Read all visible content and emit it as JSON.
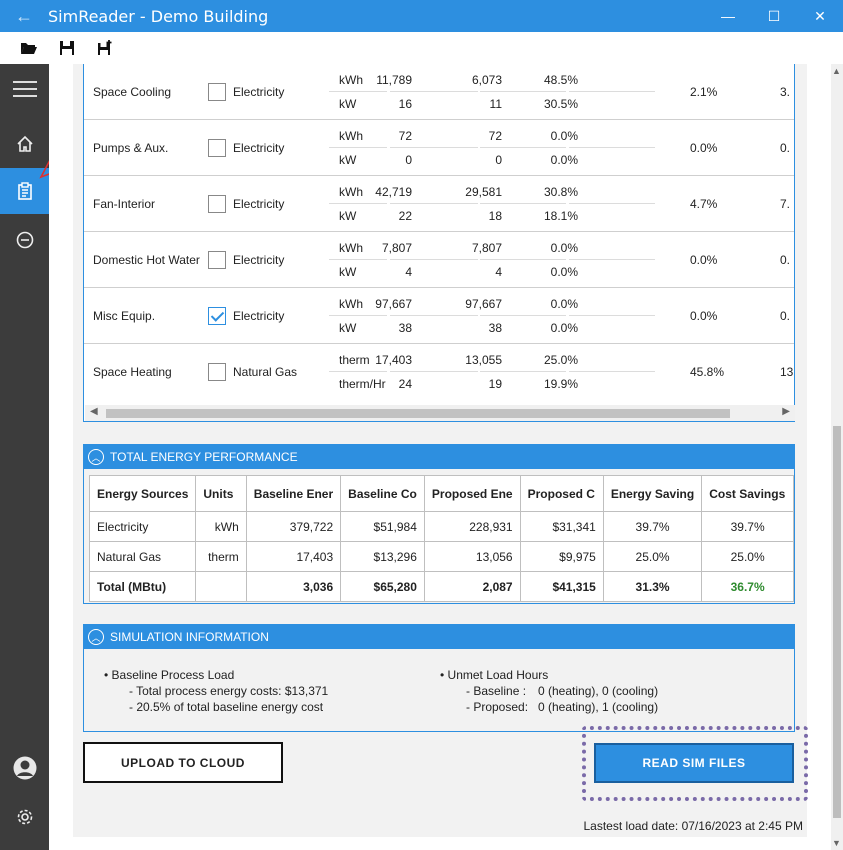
{
  "window": {
    "title": "SimReader - Demo Building",
    "back_glyph": "←",
    "minimize_glyph": "—",
    "maximize_glyph": "☐",
    "close_glyph": "✕"
  },
  "toolbar": {
    "icons": [
      "folder-open-icon",
      "save-icon",
      "save-as-icon"
    ]
  },
  "sidebar": {
    "items": [
      "menu-icon",
      "home-icon",
      "clipboard-icon",
      "more-icon",
      "user-icon",
      "gear-icon"
    ],
    "active": "clipboard-icon"
  },
  "end_uses": [
    {
      "name": "Space Cooling",
      "checked": false,
      "fuel": "Electricity",
      "rows": [
        {
          "unit": "kWh",
          "v1": "11,789",
          "v2": "6,073",
          "v3": "48.5%"
        },
        {
          "unit": "kW",
          "v1": "16",
          "v2": "11",
          "v3": "30.5%"
        }
      ],
      "extra1": "2.1%",
      "extra2": "3."
    },
    {
      "name": "Pumps & Aux.",
      "checked": false,
      "fuel": "Electricity",
      "rows": [
        {
          "unit": "kWh",
          "v1": "72",
          "v2": "72",
          "v3": "0.0%"
        },
        {
          "unit": "kW",
          "v1": "0",
          "v2": "0",
          "v3": "0.0%"
        }
      ],
      "extra1": "0.0%",
      "extra2": "0."
    },
    {
      "name": "Fan-Interior",
      "checked": false,
      "fuel": "Electricity",
      "rows": [
        {
          "unit": "kWh",
          "v1": "42,719",
          "v2": "29,581",
          "v3": "30.8%"
        },
        {
          "unit": "kW",
          "v1": "22",
          "v2": "18",
          "v3": "18.1%"
        }
      ],
      "extra1": "4.7%",
      "extra2": "7."
    },
    {
      "name": "Domestic Hot Water",
      "checked": false,
      "fuel": "Electricity",
      "rows": [
        {
          "unit": "kWh",
          "v1": "7,807",
          "v2": "7,807",
          "v3": "0.0%"
        },
        {
          "unit": "kW",
          "v1": "4",
          "v2": "4",
          "v3": "0.0%"
        }
      ],
      "extra1": "0.0%",
      "extra2": "0."
    },
    {
      "name": "Misc Equip.",
      "checked": true,
      "fuel": "Electricity",
      "rows": [
        {
          "unit": "kWh",
          "v1": "97,667",
          "v2": "97,667",
          "v3": "0.0%"
        },
        {
          "unit": "kW",
          "v1": "38",
          "v2": "38",
          "v3": "0.0%"
        }
      ],
      "extra1": "0.0%",
      "extra2": "0."
    },
    {
      "name": "Space Heating",
      "checked": false,
      "fuel": "Natural Gas",
      "rows": [
        {
          "unit": "therm",
          "v1": "17,403",
          "v2": "13,055",
          "v3": "25.0%"
        },
        {
          "unit": "therm/Hr",
          "v1": "24",
          "v2": "19",
          "v3": "19.9%"
        }
      ],
      "extra1": "45.8%",
      "extra2": "13"
    }
  ],
  "total_performance": {
    "header": "TOTAL ENERGY PERFORMANCE",
    "columns": [
      "Energy Sources",
      "Units",
      "Baseline Ener",
      "Baseline Co",
      "Proposed Ene",
      "Proposed C",
      "Energy Saving",
      "Cost Savings"
    ],
    "rows": [
      [
        "Electricity",
        "kWh",
        "379,722",
        "$51,984",
        "228,931",
        "$31,341",
        "39.7%",
        "39.7%"
      ],
      [
        "Natural Gas",
        "therm",
        "17,403",
        "$13,296",
        "13,056",
        "$9,975",
        "25.0%",
        "25.0%"
      ]
    ],
    "total": [
      "Total (MBtu)",
      "",
      "3,036",
      "$65,280",
      "2,087",
      "$41,315",
      "31.3%",
      "36.7%"
    ]
  },
  "simulation_info": {
    "header": "SIMULATION INFORMATION",
    "left_title": "• Baseline Process Load",
    "left_lines": [
      "-  Total process energy costs: $13,371",
      "-  20.5% of total baseline energy cost"
    ],
    "right_title": "• Unmet Load Hours",
    "right_labels": [
      "- Baseline  :",
      "- Proposed:"
    ],
    "right_values": [
      "0 (heating), 0 (cooling)",
      "0 (heating), 1 (cooling)"
    ]
  },
  "actions": {
    "upload_label": "UPLOAD TO CLOUD",
    "read_label": "READ SIM FILES"
  },
  "status": {
    "last_load": "Lastest load date: 07/16/2023 at 2:45 PM"
  },
  "colors": {
    "accent": "#2d8fe0",
    "sidebar": "#3c3c3c",
    "highlight_green": "#2e8b2e",
    "focus_outline": "#7a6aa8"
  }
}
